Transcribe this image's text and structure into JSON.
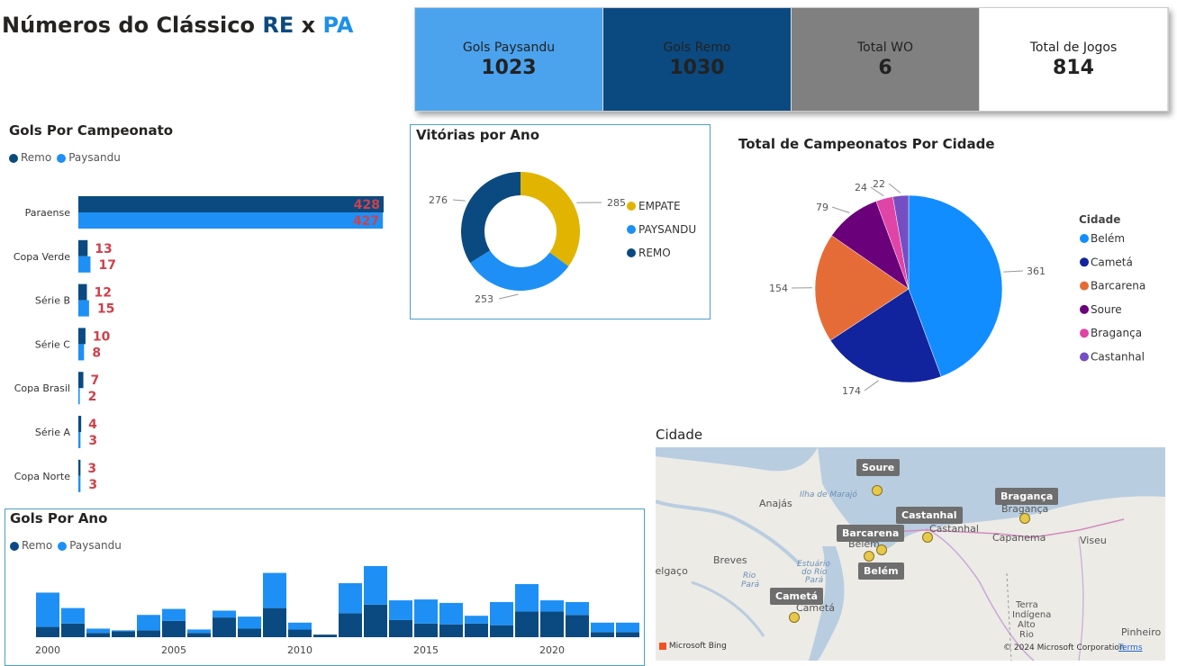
{
  "header": {
    "title_prefix": "Números do Clássico",
    "title_re": "RE",
    "title_x": "x",
    "title_pa": "PA"
  },
  "kpis": [
    {
      "label": "Gols Paysandu",
      "value": "1023",
      "bg": "#4ba3ee",
      "fg": "#222222"
    },
    {
      "label": "Gols Remo",
      "value": "1030",
      "bg": "#0b4a80",
      "fg": "#222222"
    },
    {
      "label": "Total WO",
      "value": "6",
      "bg": "#808080",
      "fg": "#222222"
    },
    {
      "label": "Total de Jogos",
      "value": "814",
      "bg": "#ffffff",
      "fg": "#222222"
    }
  ],
  "colors": {
    "remo": "#0b4a80",
    "paysandu": "#1e90f5",
    "label_red": "#d0404a",
    "empate": "#e0b400"
  },
  "gols_campeonato": {
    "title": "Gols Por Campeonato",
    "legend": [
      "Remo",
      "Paysandu"
    ],
    "chart_data": {
      "type": "bar",
      "orientation": "horizontal",
      "categories": [
        "Paraense",
        "Copa Verde",
        "Série B",
        "Série C",
        "Copa Brasil",
        "Série A",
        "Copa Norte"
      ],
      "series": [
        {
          "name": "Remo",
          "values": [
            428,
            13,
            12,
            10,
            7,
            4,
            3
          ]
        },
        {
          "name": "Paysandu",
          "values": [
            427,
            17,
            15,
            8,
            2,
            3,
            3
          ]
        }
      ],
      "xlim": [
        0,
        428
      ]
    }
  },
  "vitorias": {
    "title": "Vitórias por Ano",
    "chart_data": {
      "type": "pie",
      "donut": true,
      "labels": [
        "EMPATE",
        "PAYSANDU",
        "REMO"
      ],
      "values": [
        285,
        253,
        276
      ],
      "colors": [
        "#e0b400",
        "#1e90f5",
        "#0b4a80"
      ]
    }
  },
  "campeonatos_cidade": {
    "title": "Total de Campeonatos Por Cidade",
    "legend_title": "Cidade",
    "chart_data": {
      "type": "pie",
      "labels": [
        "Belém",
        "Cametá",
        "Barcarena",
        "Soure",
        "Bragança",
        "Castanhal"
      ],
      "values": [
        361,
        174,
        154,
        79,
        24,
        22
      ],
      "colors": [
        "#118dff",
        "#12239e",
        "#e66c37",
        "#6b007b",
        "#e044a7",
        "#744ec2"
      ]
    }
  },
  "gols_ano": {
    "title": "Gols Por Ano",
    "legend": [
      "Remo",
      "Paysandu"
    ],
    "chart_data": {
      "type": "bar",
      "stacked": true,
      "x_ticks": [
        "2000",
        "2005",
        "2010",
        "2015",
        "2020"
      ],
      "x": [
        2000,
        2001,
        2002,
        2003,
        2004,
        2005,
        2006,
        2007,
        2008,
        2009,
        2010,
        2011,
        2012,
        2013,
        2014,
        2015,
        2016,
        2017,
        2018,
        2019,
        2020,
        2021,
        2022,
        2023
      ],
      "series": [
        {
          "name": "Remo",
          "values": [
            12,
            16,
            5,
            7,
            8,
            19,
            5,
            23,
            10,
            34,
            9,
            3,
            28,
            38,
            20,
            16,
            15,
            16,
            14,
            30,
            30,
            26,
            6,
            6
          ]
        },
        {
          "name": "Paysandu",
          "values": [
            40,
            18,
            5,
            1,
            18,
            14,
            4,
            8,
            14,
            41,
            8,
            0,
            35,
            45,
            23,
            28,
            25,
            9,
            27,
            32,
            13,
            15,
            11,
            11
          ]
        }
      ]
    }
  },
  "mapa": {
    "title": "Cidade",
    "labels": [
      "Soure",
      "Castanhal",
      "Bragança",
      "Barcarena",
      "Belém",
      "Cametá"
    ],
    "places": [
      "Anajás",
      "Breves",
      "Belém",
      "Castanhal",
      "Bragança",
      "Capanema",
      "Viseu",
      "Cametá",
      "Pinheiro",
      "Terra",
      "Indígena",
      "Alto",
      "Rio",
      "Melgaço"
    ],
    "water": [
      "Ilha de Marajó",
      "Estuário",
      "do Rio",
      "Pará",
      "Rio",
      "Pará"
    ],
    "bing": "Microsoft Bing",
    "copyright": "© 2024 Microsoft Corporation",
    "terms": "Terms"
  }
}
